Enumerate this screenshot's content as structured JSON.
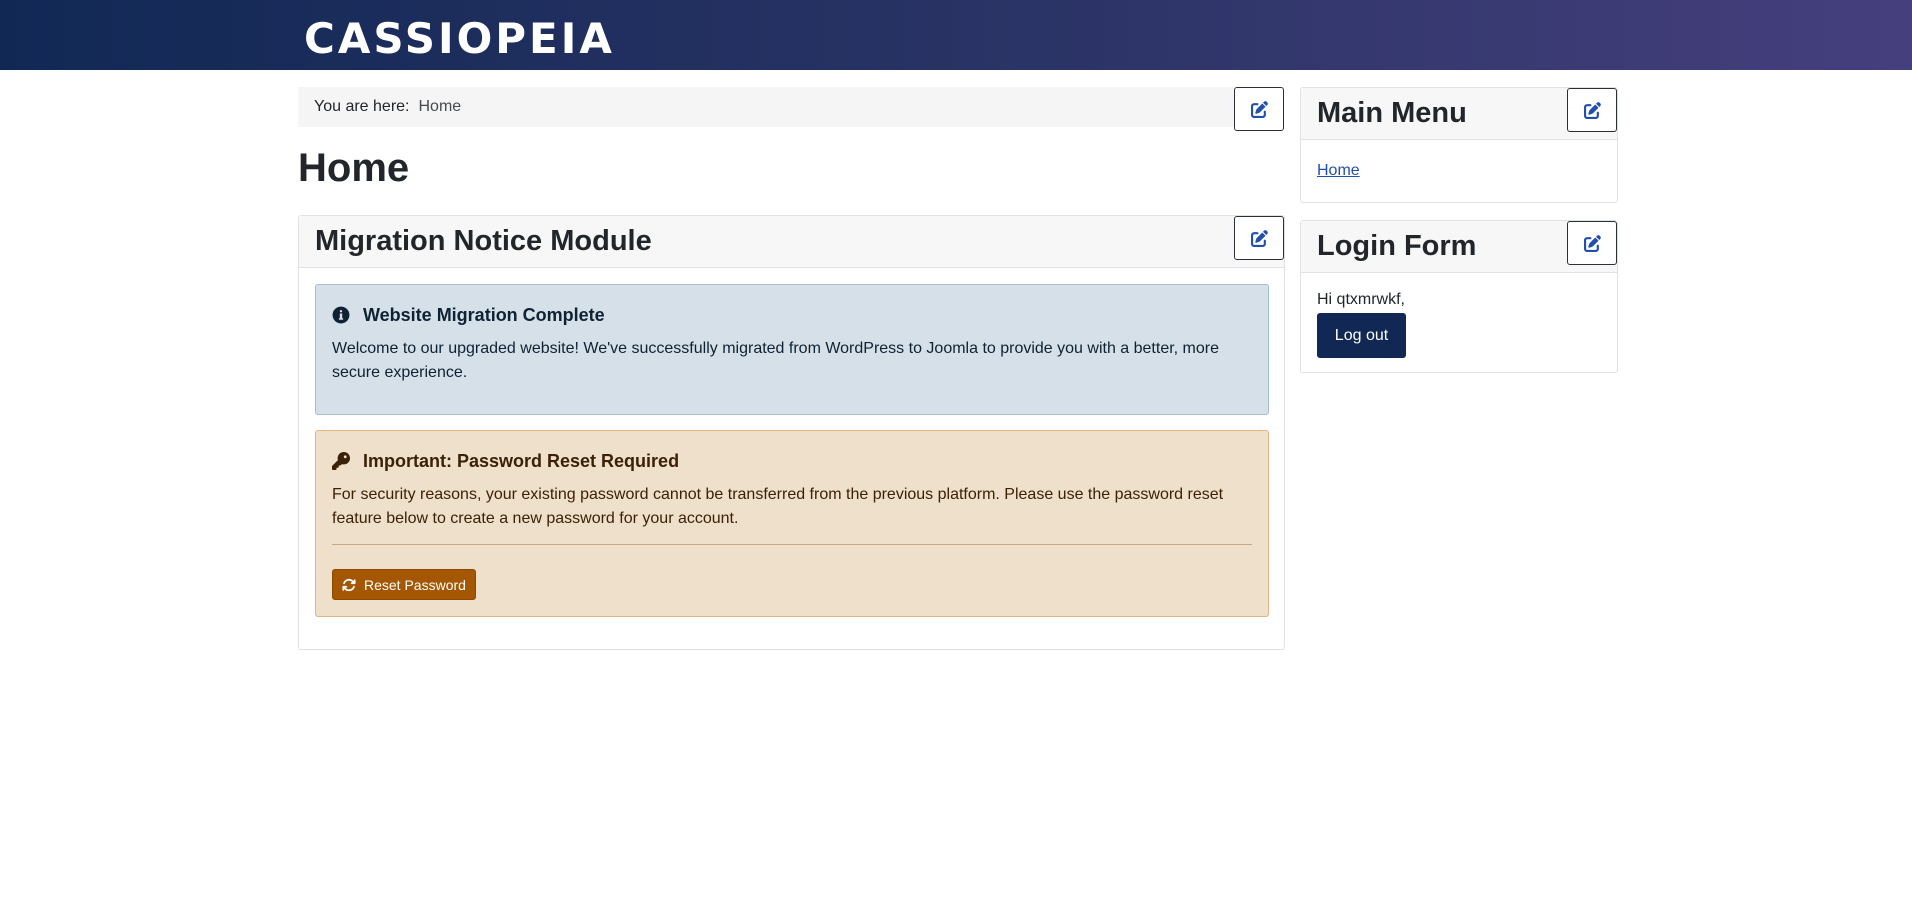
{
  "header": {
    "brand": "CASSIOPEIA"
  },
  "breadcrumb": {
    "prefix": "You are here:",
    "items": [
      "Home"
    ]
  },
  "page": {
    "title": "Home"
  },
  "migration_module": {
    "title": "Migration Notice Module",
    "info_alert": {
      "icon": "info-circle-icon",
      "title": "Website Migration Complete",
      "text": "Welcome to our upgraded website! We've successfully migrated from WordPress to Joomla to provide you with a better, more secure experience."
    },
    "warning_alert": {
      "icon": "key-icon",
      "title": "Important: Password Reset Required",
      "text": "For security reasons, your existing password cannot be transferred from the previous platform. Please use the password reset feature below to create a new password for your account.",
      "button_label": "Reset Password",
      "button_icon": "sync-icon"
    }
  },
  "main_menu": {
    "title": "Main Menu",
    "items": [
      "Home"
    ]
  },
  "login_form": {
    "title": "Login Form",
    "greeting": "Hi qtxmrwkf,",
    "logout_label": "Log out"
  },
  "icons": {
    "edit": "edit-icon"
  },
  "colors": {
    "header_start": "#112855",
    "header_end": "#463f7e",
    "info_bg": "#d5e0e8",
    "warning_bg": "#efe0cb",
    "warning_button": "#a45700",
    "logout_button": "#112855",
    "link": "#224faa"
  }
}
